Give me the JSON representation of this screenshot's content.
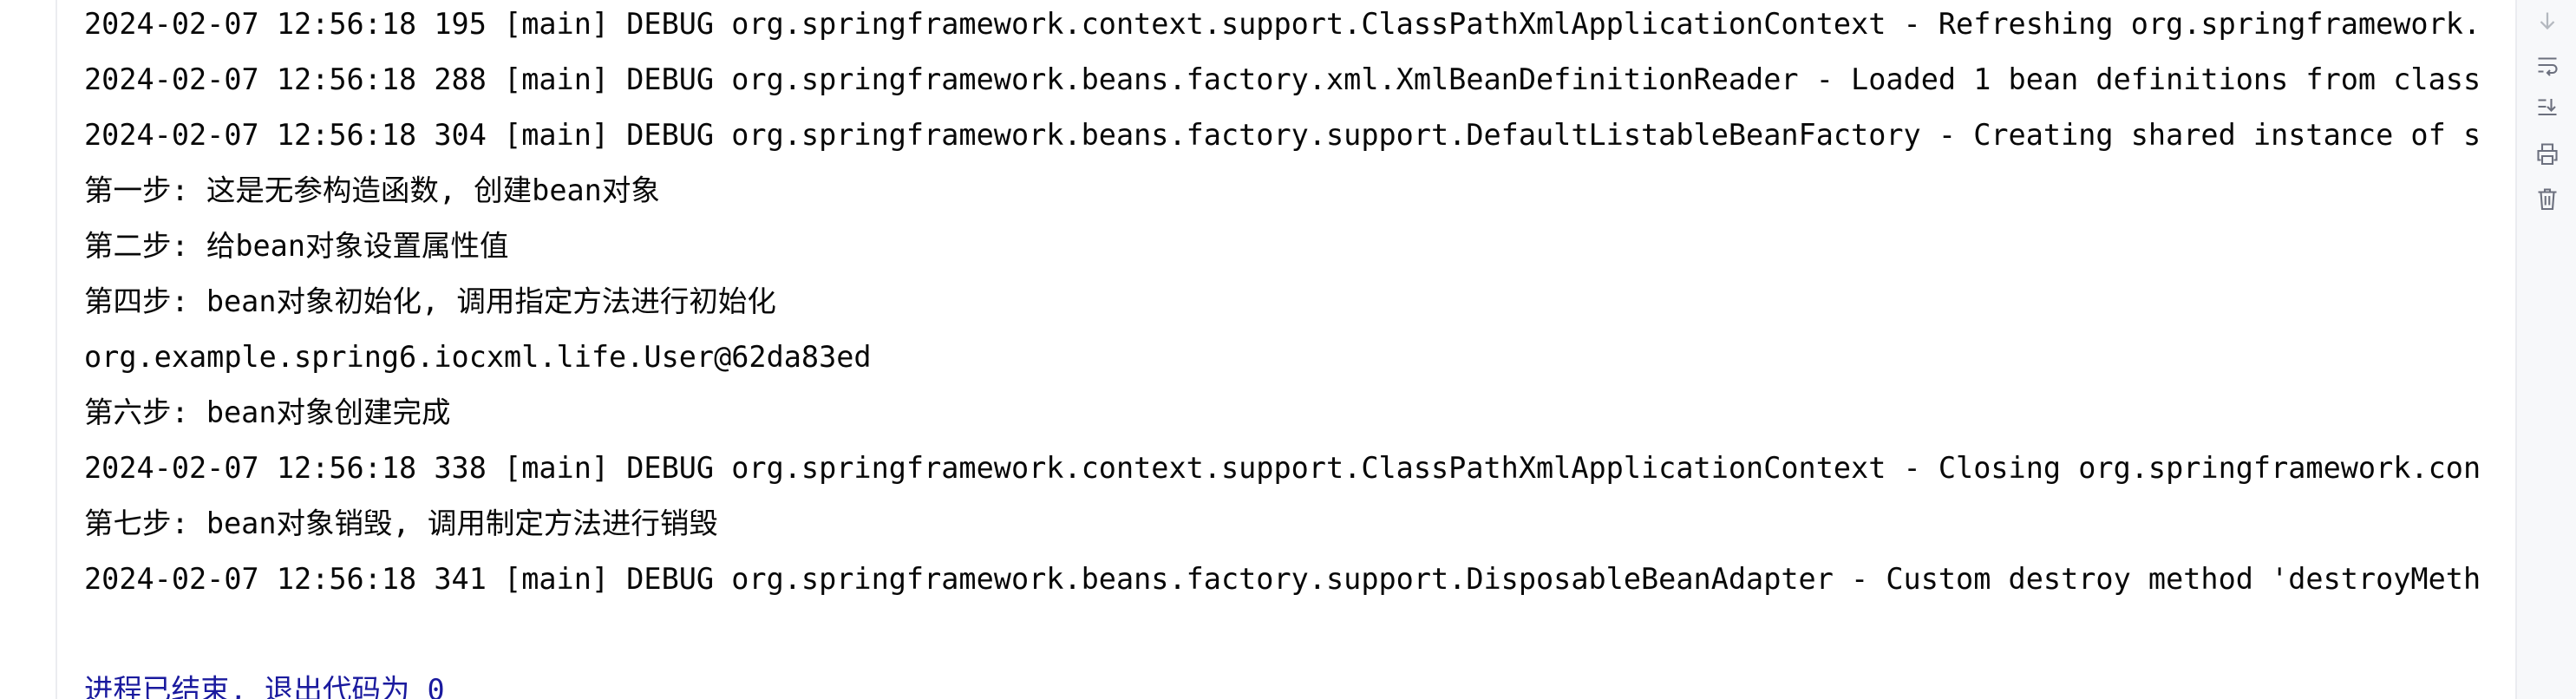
{
  "console": {
    "lines": [
      "2024-02-07 12:56:18 195 [main] DEBUG org.springframework.context.support.ClassPathXmlApplicationContext - Refreshing org.springframework.",
      "2024-02-07 12:56:18 288 [main] DEBUG org.springframework.beans.factory.xml.XmlBeanDefinitionReader - Loaded 1 bean definitions from class",
      "2024-02-07 12:56:18 304 [main] DEBUG org.springframework.beans.factory.support.DefaultListableBeanFactory - Creating shared instance of s",
      "第一步: 这是无参构造函数, 创建bean对象",
      "第二步: 给bean对象设置属性值",
      "第四步: bean对象初始化, 调用指定方法进行初始化",
      "org.example.spring6.iocxml.life.User@62da83ed",
      "第六步: bean对象创建完成",
      "2024-02-07 12:56:18 338 [main] DEBUG org.springframework.context.support.ClassPathXmlApplicationContext - Closing org.springframework.con",
      "第七步: bean对象销毁, 调用制定方法进行销毁",
      "2024-02-07 12:56:18 341 [main] DEBUG org.springframework.beans.factory.support.DisposableBeanAdapter - Custom destroy method 'destroyMeth"
    ],
    "exit_message": "进程已结束, 退出代码为 0"
  },
  "toolbar": {
    "buttons": [
      {
        "icon": "scroll-down-icon"
      },
      {
        "icon": "soft-wrap-icon"
      },
      {
        "icon": "scroll-to-end-icon"
      },
      {
        "icon": "print-icon"
      },
      {
        "icon": "trash-icon"
      }
    ]
  }
}
